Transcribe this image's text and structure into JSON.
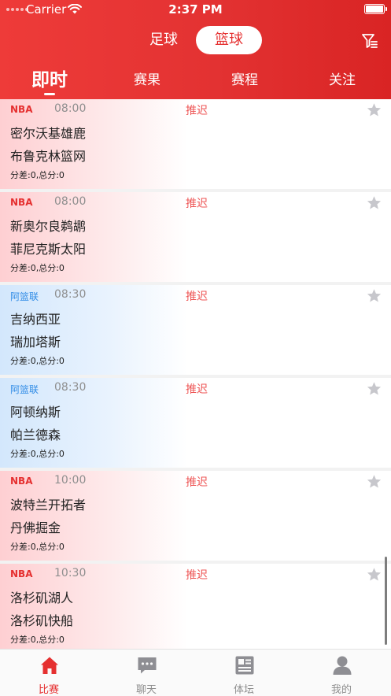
{
  "status_bar": {
    "carrier": "Carrier",
    "time": "2:37 PM"
  },
  "sport_toggle": {
    "football": "足球",
    "basketball": "篮球",
    "selected": "篮球"
  },
  "tabs": [
    {
      "label": "即时"
    },
    {
      "label": "赛果"
    },
    {
      "label": "赛程"
    },
    {
      "label": "关注"
    }
  ],
  "active_tab": "即时",
  "colors": {
    "brand_red": "#e53030",
    "nba_label": "#e53030",
    "alb_label": "#2f8be6",
    "status_red": "#ee5454"
  },
  "matches": [
    {
      "league": "NBA",
      "league_type": "nba",
      "time": "08:00",
      "status": "推迟",
      "home": "密尔沃基雄鹿",
      "away": "布鲁克林篮网",
      "score_line": "分差:0,总分:0"
    },
    {
      "league": "NBA",
      "league_type": "nba",
      "time": "08:00",
      "status": "推迟",
      "home": "新奥尔良鹈鹕",
      "away": "菲尼克斯太阳",
      "score_line": "分差:0,总分:0"
    },
    {
      "league": "阿篮联",
      "league_type": "alb",
      "time": "08:30",
      "status": "推迟",
      "home": "吉纳西亚",
      "away": "瑞加塔斯",
      "score_line": "分差:0,总分:0"
    },
    {
      "league": "阿篮联",
      "league_type": "alb",
      "time": "08:30",
      "status": "推迟",
      "home": "阿顿纳斯",
      "away": "帕兰德森",
      "score_line": "分差:0,总分:0"
    },
    {
      "league": "NBA",
      "league_type": "nba",
      "time": "10:00",
      "status": "推迟",
      "home": "波特兰开拓者",
      "away": "丹佛掘金",
      "score_line": "分差:0,总分:0"
    },
    {
      "league": "NBA",
      "league_type": "nba",
      "time": "10:30",
      "status": "推迟",
      "home": "洛杉矶湖人",
      "away": "洛杉矶快船",
      "score_line": "分差:0,总分:0"
    }
  ],
  "tab_bar": [
    {
      "label": "比赛",
      "icon": "home-icon",
      "active": true
    },
    {
      "label": "聊天",
      "icon": "chat-icon",
      "active": false
    },
    {
      "label": "体坛",
      "icon": "news-icon",
      "active": false
    },
    {
      "label": "我的",
      "icon": "profile-icon",
      "active": false
    }
  ]
}
